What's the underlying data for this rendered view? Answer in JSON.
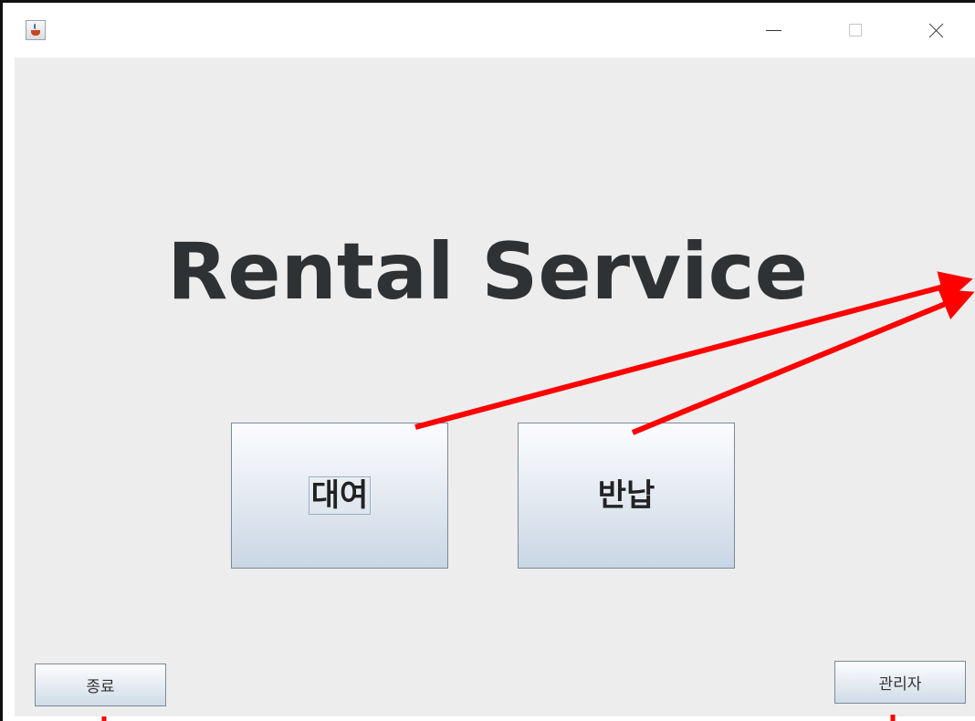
{
  "window": {
    "title": "",
    "icon": "java-cup-icon"
  },
  "titlebar_controls": [
    "minimize-icon",
    "maximize-icon",
    "close-icon"
  ],
  "main": {
    "title": "Rental Service",
    "rent_button": "대여",
    "return_button": "반납"
  },
  "footer": {
    "exit_button": "종료",
    "admin_button": "관리자"
  },
  "annotation": {
    "arrow_color": "#ff0000"
  }
}
